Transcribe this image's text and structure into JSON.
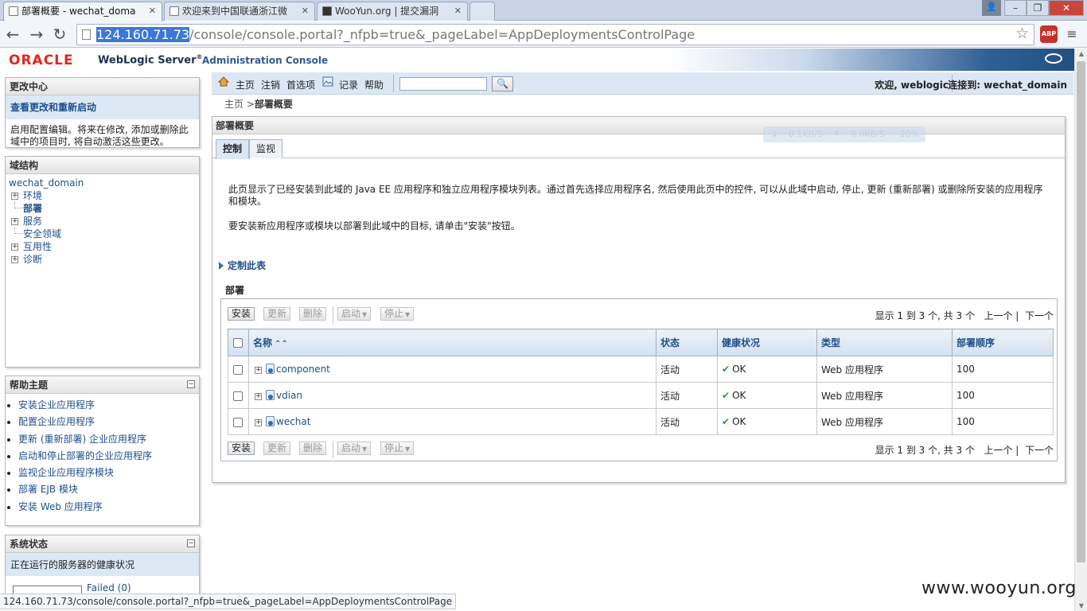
{
  "browser": {
    "tabs": [
      {
        "title": "部署概要 - wechat_doma",
        "active": true
      },
      {
        "title": "欢迎来到中国联通浙江微",
        "active": false
      },
      {
        "title": "WooYun.org | 提交漏洞",
        "active": false
      }
    ],
    "url_host": "124.160.71.73",
    "url_rest": "/console/console.portal?_nfpb=true&_pageLabel=AppDeploymentsControlPage",
    "abp_label": "ABP",
    "status_url": "124.160.71.73/console/console.portal?_nfpb=true&_pageLabel=AppDeploymentsControlPage"
  },
  "header": {
    "oracle": "ORACLE",
    "product": "WebLogic Server",
    "reg": "®",
    "console": "Administration Console"
  },
  "change_center": {
    "title": "更改中心",
    "link": "查看更改和重新启动",
    "desc": "启用配置编辑。将来在修改, 添加或删除此域中的项目时, 将自动激活这些更改。"
  },
  "domain_structure": {
    "title": "域结构",
    "root": "wechat_domain",
    "nodes": [
      "环境",
      "部署",
      "服务",
      "安全领域",
      "互用性",
      "诊断"
    ]
  },
  "help_topics": {
    "title": "帮助主题",
    "collapse": "−",
    "items": [
      "安装企业应用程序",
      "配置企业应用程序",
      "更新 (重新部署) 企业应用程序",
      "启动和停止部署的企业应用程序",
      "监视企业应用程序模块",
      "部署 EJB 模块",
      "安装 Web 应用程序"
    ]
  },
  "system_status": {
    "title": "系统状态",
    "collapse": "−",
    "subtitle": "正在运行的服务器的健康状况",
    "failed": "Failed (0)"
  },
  "main_toolbar": {
    "home": "主页",
    "logout": "注销",
    "prefs": "首选项",
    "record": "记录",
    "help": "帮助",
    "search_button": "🔍",
    "welcome": "欢迎, weblogic",
    "connected": "连接到: wechat_domain"
  },
  "breadcrumb": {
    "home": "主页",
    "sep": " >",
    "current": "部署概要"
  },
  "content": {
    "title": "部署概要",
    "tabs": [
      "控制",
      "监视"
    ],
    "speed": {
      "down": "0.1KB/S",
      "up": "0.0KB/S",
      "pct": "20%"
    },
    "desc1": "此页显示了已经安装到此域的 Java EE 应用程序和独立应用程序模块列表。通过首先选择应用程序名, 然后使用此页中的控件, 可以从此域中启动, 停止, 更新 (重新部署) 或删除所安装的应用程序和模块。",
    "desc2": "要安装新应用程序或模块以部署到此域中的目标, 请单击\"安装\"按钮。",
    "customize": "定制此表",
    "section": "部署",
    "buttons": {
      "install": "安装",
      "update": "更新",
      "delete": "删除",
      "start": "启动",
      "stop": "停止"
    },
    "pager": {
      "summary": "显示 1 到 3 个, 共 3 个",
      "prev": "上一个",
      "sep": "|",
      "next": "下一个"
    },
    "columns": [
      "名称",
      "状态",
      "健康状况",
      "类型",
      "部署顺序"
    ],
    "rows": [
      {
        "name": "component",
        "state": "活动",
        "health": "OK",
        "type": "Web 应用程序",
        "order": "100"
      },
      {
        "name": "vdian",
        "state": "活动",
        "health": "OK",
        "type": "Web 应用程序",
        "order": "100"
      },
      {
        "name": "wechat",
        "state": "活动",
        "health": "OK",
        "type": "Web 应用程序",
        "order": "100"
      }
    ]
  },
  "watermark": "www.wooyun.org"
}
